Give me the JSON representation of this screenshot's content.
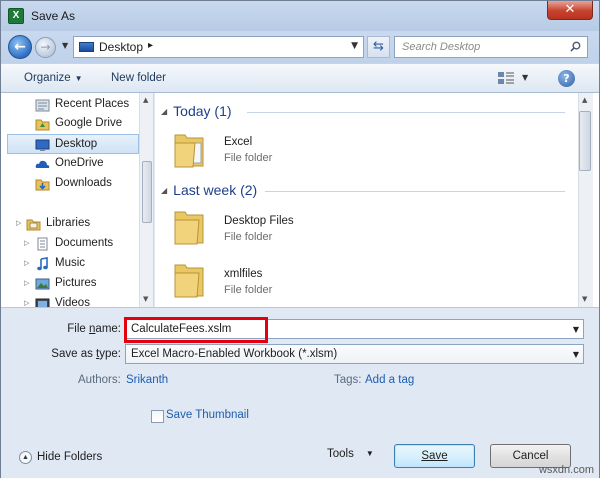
{
  "window": {
    "title": "Save As",
    "app_icon_letter": "X"
  },
  "address_bar": {
    "location": "Desktop",
    "separator": "▸"
  },
  "search": {
    "placeholder": "Search Desktop"
  },
  "toolbar": {
    "organize_label": "Organize",
    "new_folder_label": "New folder",
    "help_label": "?"
  },
  "sidebar": {
    "items": [
      {
        "label": "Recent Places",
        "icon": "recent-places-icon"
      },
      {
        "label": "Google Drive",
        "icon": "google-drive-icon"
      },
      {
        "label": "Desktop",
        "icon": "desktop-icon",
        "selected": true
      },
      {
        "label": "OneDrive",
        "icon": "onedrive-icon"
      },
      {
        "label": "Downloads",
        "icon": "downloads-icon"
      },
      {
        "label": "Libraries",
        "icon": "libraries-icon"
      },
      {
        "label": "Documents",
        "icon": "documents-icon"
      },
      {
        "label": "Music",
        "icon": "music-icon"
      },
      {
        "label": "Pictures",
        "icon": "pictures-icon"
      },
      {
        "label": "Videos",
        "icon": "videos-icon"
      }
    ]
  },
  "groups": [
    {
      "header": "Today (1)",
      "items": [
        {
          "name": "Excel",
          "type": "File folder"
        }
      ]
    },
    {
      "header": "Last week (2)",
      "items": [
        {
          "name": "Desktop Files",
          "type": "File folder"
        },
        {
          "name": "xmlfiles",
          "type": "File folder"
        }
      ]
    }
  ],
  "form": {
    "file_name_label_pre": "File ",
    "file_name_label_key": "n",
    "file_name_label_post": "ame:",
    "file_name_value": "CalculateFees.xslm",
    "save_type_label_pre": "Save as ",
    "save_type_label_key": "t",
    "save_type_label_post": "ype:",
    "save_type_value": "Excel Macro-Enabled Workbook (*.xlsm)",
    "authors_label": "Authors:",
    "authors_value": "Srikanth",
    "tags_label": "Tags:",
    "tags_value": "Add a tag",
    "save_thumbnail_label": "Save Thumbnail",
    "save_thumbnail_checked": false
  },
  "footer": {
    "hide_folders_label": "Hide Folders",
    "tools_label": "Tools",
    "save_label": "Save",
    "cancel_label": "Cancel",
    "watermark": "wsxdn.com"
  },
  "colors": {
    "highlight": "#e3000f",
    "link": "#1e5eb0",
    "group_header": "#1e3f8a"
  }
}
